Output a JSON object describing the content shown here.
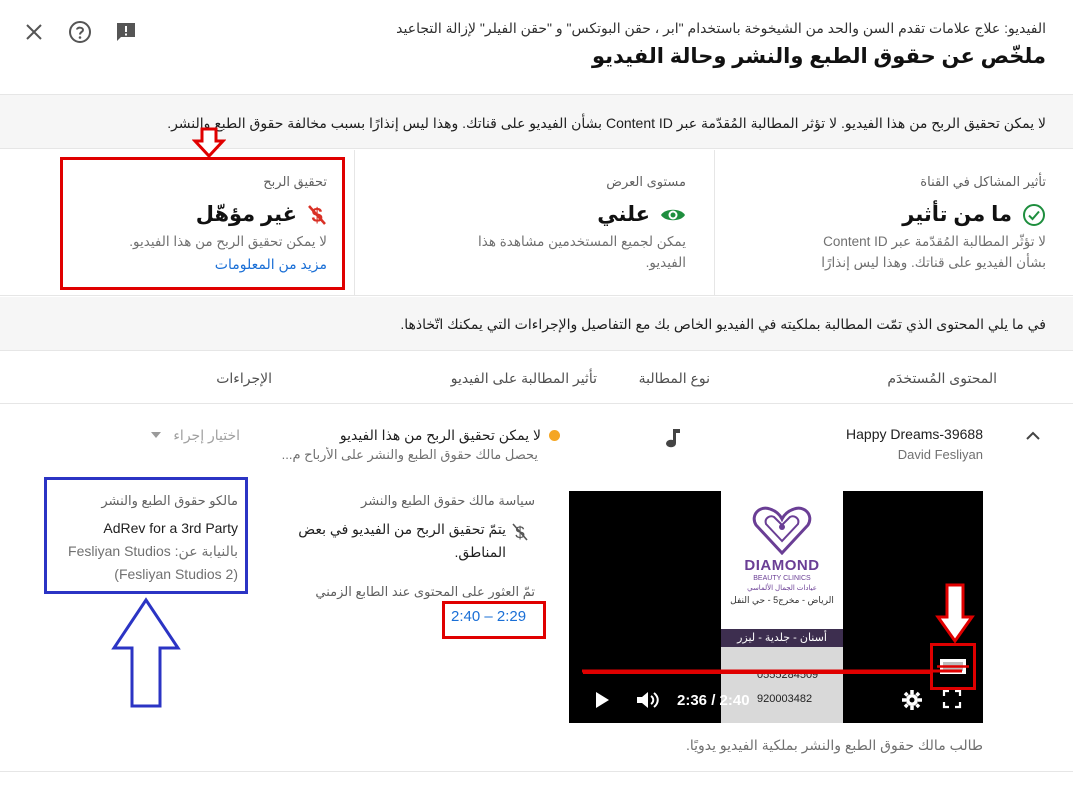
{
  "header": {
    "video_title": "الفيديو: علاج علامات تقدم السن والحد من الشيخوخة باستخدام \"ابر ، حقن البوتكس\" و \"حقن الفيلر\" لإزالة التجاعيد",
    "page_title": "ملخّص عن حقوق الطبع والنشر وحالة الفيديو",
    "icons": [
      "close-icon",
      "help-icon",
      "feedback-icon"
    ]
  },
  "notice": "لا يمكن تحقيق الربح من هذا الفيديو. لا تؤثر المطالبة المُقدّمة عبر Content ID بشأن الفيديو على قناتك. وهذا ليس إنذارًا بسبب مخالفة حقوق الطبع والنشر.",
  "cards": [
    {
      "label": "تأثير المشاكل في القناة",
      "value": "ما من تأثير",
      "desc_line1": "لا تؤثّر المطالبة المُقدّمة عبر Content ID",
      "desc_line2": "بشأن الفيديو على قناتك. وهذا ليس إنذارًا"
    },
    {
      "label": "مستوى العرض",
      "value": "علني",
      "desc_line1": "يمكن لجميع المستخدمين مشاهدة هذا",
      "desc_line2": "الفيديو."
    },
    {
      "label": "تحقيق الربح",
      "value": "غير مؤهّل",
      "desc_line1": "لا يمكن تحقيق الربح من هذا الفيديو.",
      "link": "مزيد من المعلومات"
    }
  ],
  "info": "في ما يلي المحتوى الذي تمّت المطالبة بملكيته في الفيديو الخاص بك مع التفاصيل والإجراءات التي يمكنك اتّخاذها.",
  "table": {
    "headers": {
      "content": "المحتوى المُستخدَم",
      "claim_type": "نوع المطالبة",
      "impact": "تأثير المطالبة على الفيديو",
      "actions": "الإجراءات"
    },
    "row": {
      "content_name": "Happy Dreams-39688",
      "content_artist": "David Fesliyan",
      "impact_title": "لا يمكن تحقيق الربح من هذا الفيديو",
      "impact_sub": "يحصل مالك حقوق الطبع والنشر على الأرباح م...",
      "action_placeholder": "اختيار إجراء"
    }
  },
  "details": {
    "policy_label": "سياسة مالك حقوق الطبع والنشر",
    "policy_text": "يتمّ تحقيق الربح من الفيديو في بعض المناطق.",
    "found_label": "تمّ العثور على المحتوى عند الطابع الزمني",
    "timestamp": "2:40 – 2:29",
    "owners_label": "مالكو حقوق الطبع والنشر",
    "owner_name": "AdRev for a 3rd Party",
    "owner_behalf": "بالنيابة عن: Fesliyan Studios",
    "owner_sub": "(Fesliyan Studios 2)"
  },
  "video": {
    "time": "2:36 / 2:40",
    "progress": 0.975,
    "brand": "DIAMOND",
    "brand_sub": "BEAUTY CLINICS",
    "brand_ar": "عيادات الجمال الألماسي",
    "address": "الرياض - مخرج5 - حي النفل",
    "services": "أسنان - جلدية - ليزر",
    "phone1": "0555284509",
    "phone2": "920003482",
    "caption": "طالب مالك حقوق الطبع والنشر بملكية الفيديو يدويًا."
  },
  "colors": {
    "accent": "#1a6fd6",
    "success": "#1e8e3e",
    "error": "#d93025",
    "warning": "#f5a623",
    "annotation_red": "#e00000",
    "annotation_blue": "#2b34c4"
  }
}
